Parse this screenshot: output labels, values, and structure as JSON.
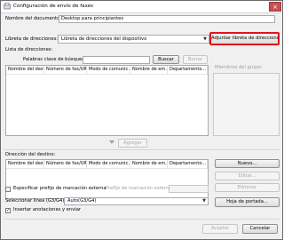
{
  "window": {
    "title": "Configuración de envío de faxes",
    "close_glyph": "×"
  },
  "document": {
    "label": "Nombre del documento:",
    "value": "Desktop para principiantes"
  },
  "address_book": {
    "label": "Libreta de direcciones:",
    "selected": "Libreta de direcciones del dispositivo",
    "attach_button": "Adjuntar libreta de direcciones"
  },
  "address_list": {
    "label": "Lista de direcciones:",
    "search_label": "Palabras clave de búsqueda:",
    "search_value": "",
    "search_button": "Buscar",
    "clear_button": "Borrar",
    "columns": [
      "Nombre del destino",
      "Número de fax/URI",
      "Modo de comunic...",
      "Nombre de em...",
      "Departamento..."
    ],
    "group_members_label": "Miembros del grupo:"
  },
  "add_button": "Agregar",
  "destinations": {
    "label": "Dirección del destino:",
    "columns": [
      "Nombre del destino",
      "Número de fax/URI",
      "Modo de comunic...",
      "Nombre de em...",
      "Departamento..."
    ],
    "new_button": "Nuevo...",
    "edit_button": "Editar...",
    "delete_button": "Eliminar",
    "cover_button": "Hoja de portada..."
  },
  "prefix": {
    "checkbox_label": "Especificar prefijo de marcación externa",
    "checked": false,
    "field_label": "Prefijo de marcación externa:",
    "value": ""
  },
  "line": {
    "label": "Seleccionar línea (G3/G4):",
    "selected": "Auto(G3/G4)"
  },
  "annotations": {
    "label": "Insertar anotaciones y enviar",
    "checked": true,
    "check_glyph": "✓"
  },
  "footer": {
    "accept_button": "Aceptar",
    "cancel_button": "Cancelar"
  },
  "icons": {
    "dropdown": "chevron-down-icon",
    "resize": "resize-grip-icon"
  },
  "colors": {
    "highlight": "#e0141b",
    "close": "#c75050"
  }
}
